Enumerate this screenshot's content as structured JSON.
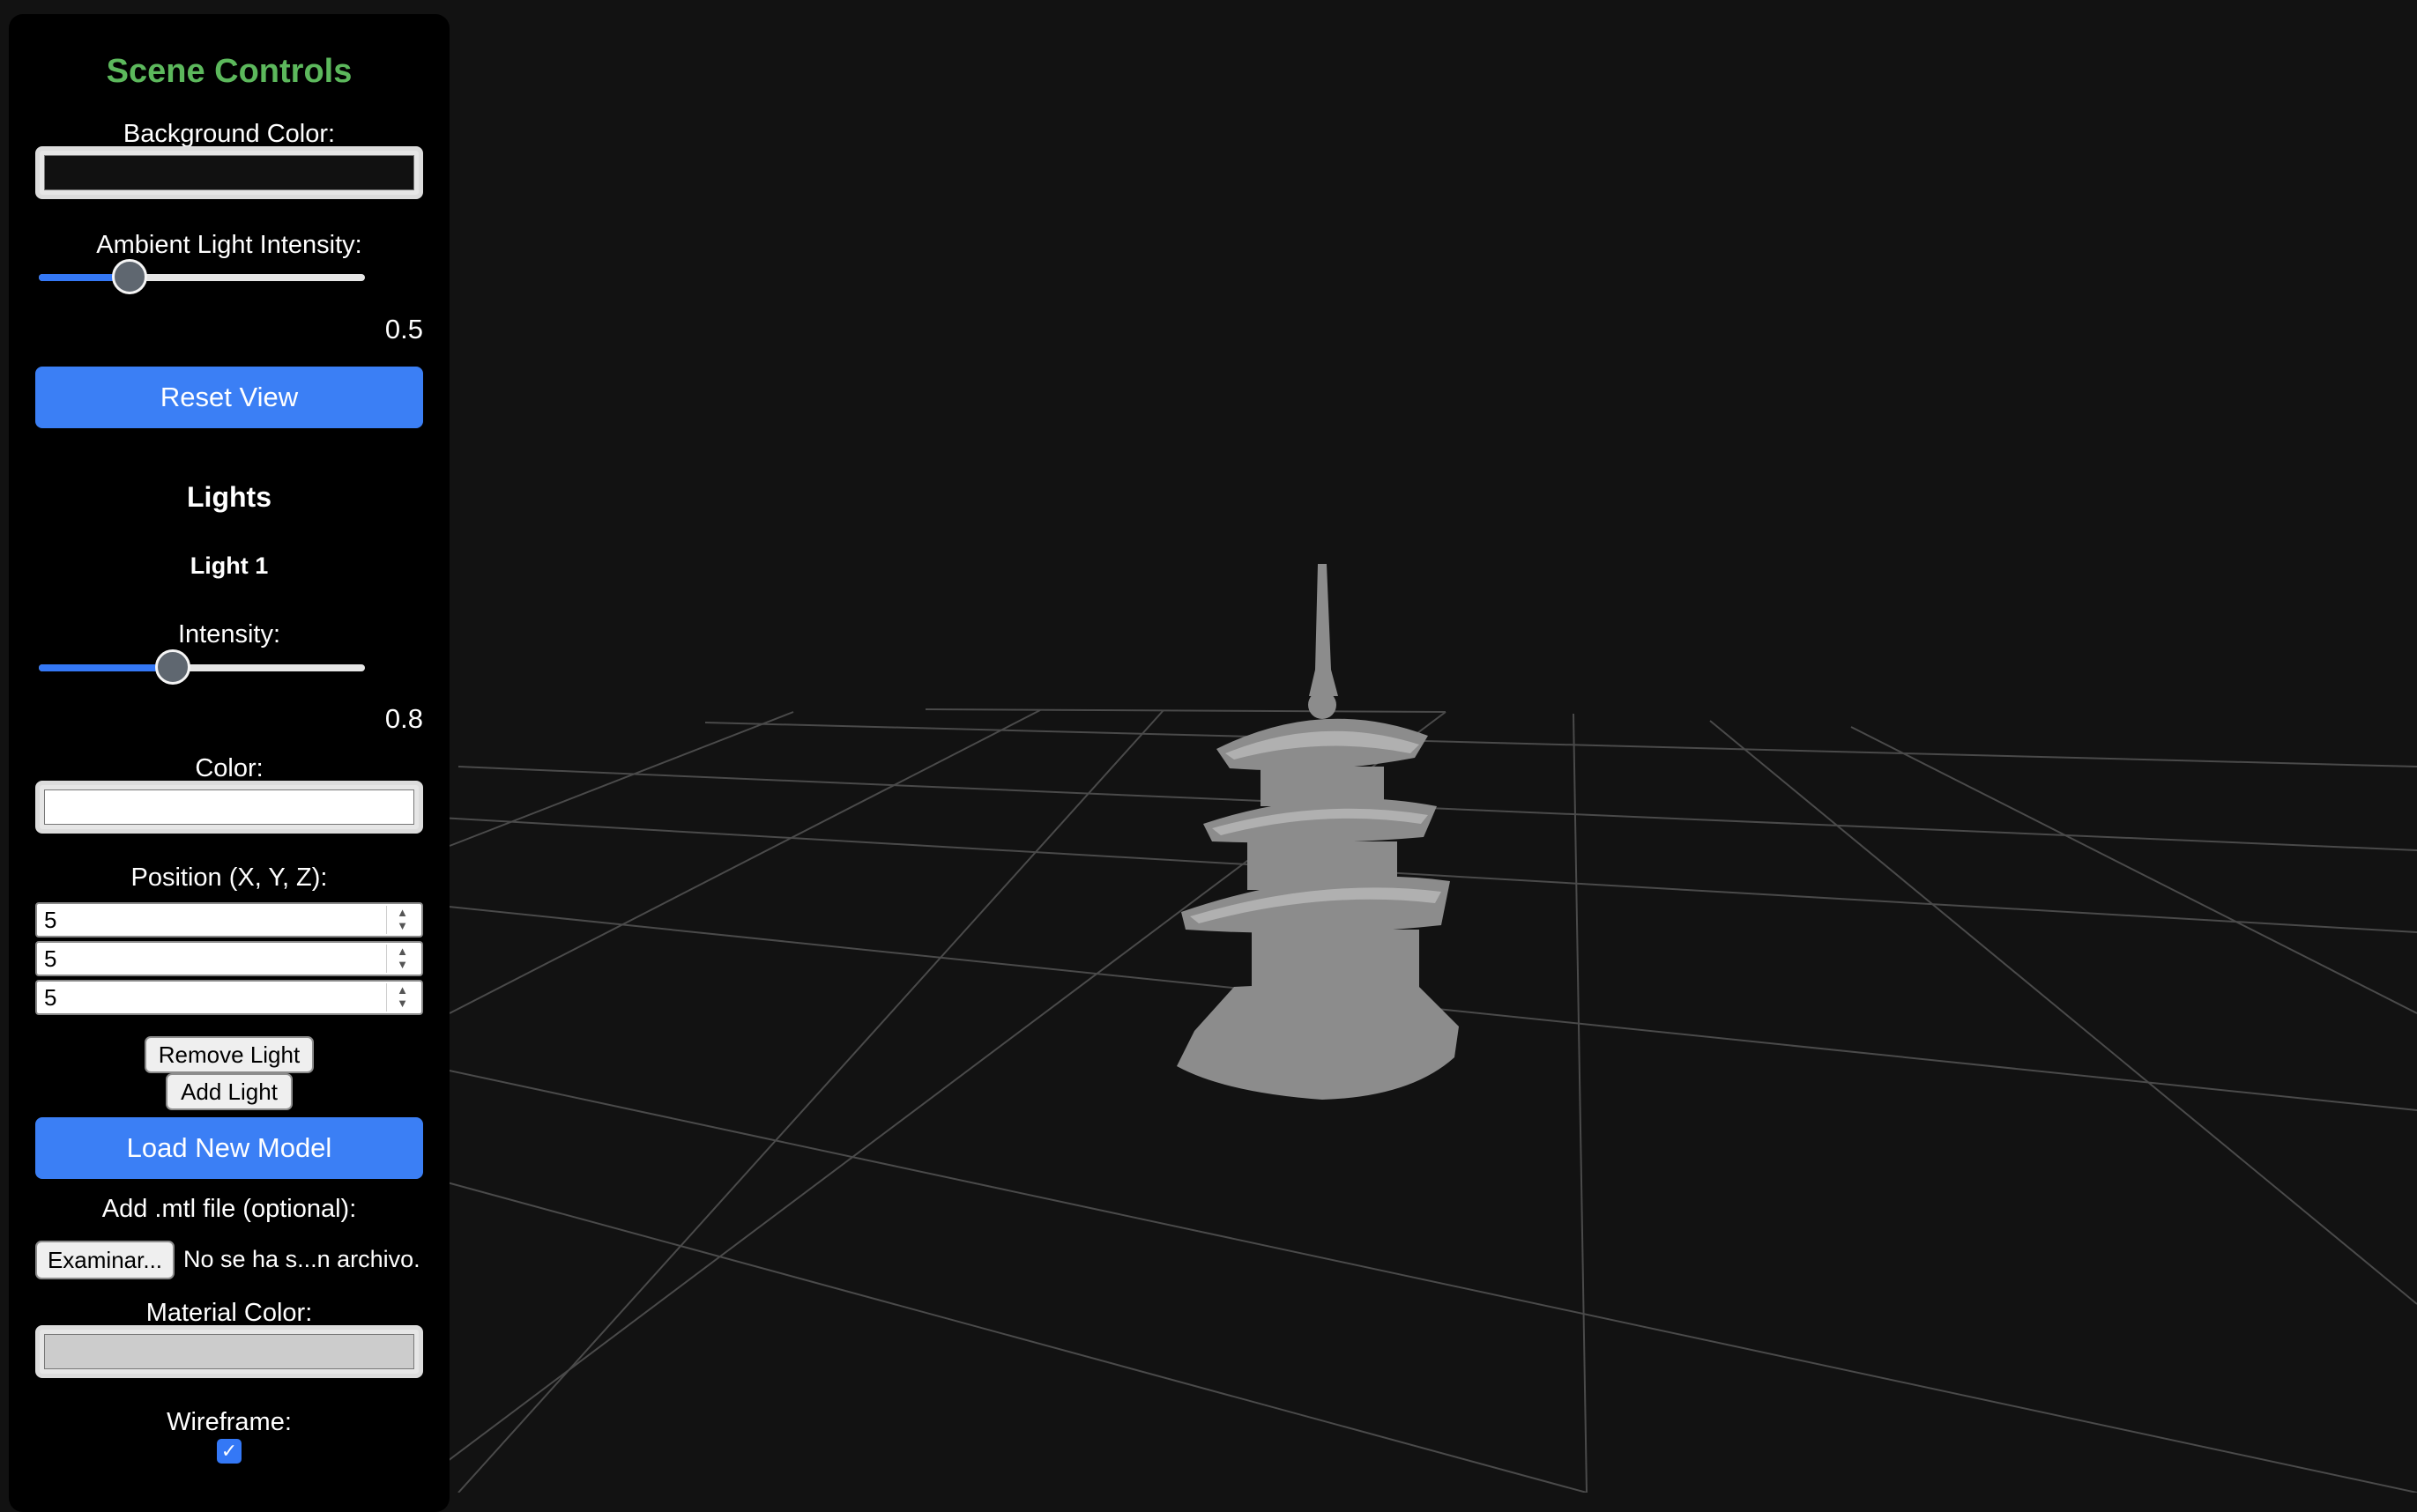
{
  "panel": {
    "title": "Scene Controls",
    "background_color": {
      "label": "Background Color:",
      "value": "#111111"
    },
    "ambient_light": {
      "label": "Ambient Light Intensity:",
      "value": "0.5",
      "level": 0.5
    },
    "reset_view_label": "Reset View",
    "lights": {
      "title": "Lights",
      "items": [
        {
          "title": "Light 1",
          "intensity_label": "Intensity:",
          "intensity_value": "0.8",
          "intensity_level": 0.8,
          "color_label": "Color:",
          "color_value": "#ffffff",
          "position_label": "Position (X, Y, Z):",
          "position": {
            "x": "5",
            "y": "5",
            "z": "5"
          }
        }
      ],
      "remove_light_label": "Remove Light",
      "add_light_label": "Add Light"
    },
    "load_model_label": "Load New Model",
    "mtl_file": {
      "label": "Add .mtl file (optional):",
      "button_label": "Examinar...",
      "status": "No se ha s...n archivo."
    },
    "material_color": {
      "label": "Material Color:",
      "value": "#cccccc"
    },
    "wireframe": {
      "label": "Wireframe:",
      "checked": true,
      "check_glyph": "✓"
    }
  },
  "viewport": {
    "background": "#121212",
    "grid_color": "#555555",
    "model_color": "#8c8c8c",
    "model_icon": "pagoda-model"
  },
  "colors": {
    "accent": "#3b7ff5",
    "title": "#5cb85c"
  }
}
